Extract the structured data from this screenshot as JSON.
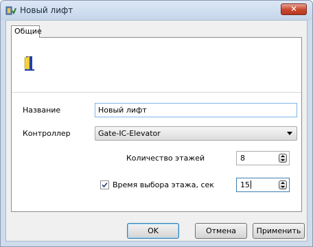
{
  "window": {
    "title": "Новый лифт",
    "title_icon": "elevator-app-icon",
    "close_label": "✕"
  },
  "tabs": [
    {
      "label": "Общие",
      "active": true
    }
  ],
  "header_icon": "door-icon",
  "form": {
    "name_label": "Название",
    "name_value": "Новый лифт",
    "controller_label": "Контроллер",
    "controller_value": "Gate-IC-Elevator",
    "floors_label": "Количество этажей",
    "floors_value": "8",
    "floor_select_time_label": "Время выбора этажа, сек",
    "floor_select_time_checked": true,
    "floor_select_time_value": "15"
  },
  "buttons": {
    "ok": "OK",
    "cancel": "Отмена",
    "apply": "Применить"
  },
  "colors": {
    "accent_border": "#3c7fb1",
    "close_button": "#c9472d"
  }
}
